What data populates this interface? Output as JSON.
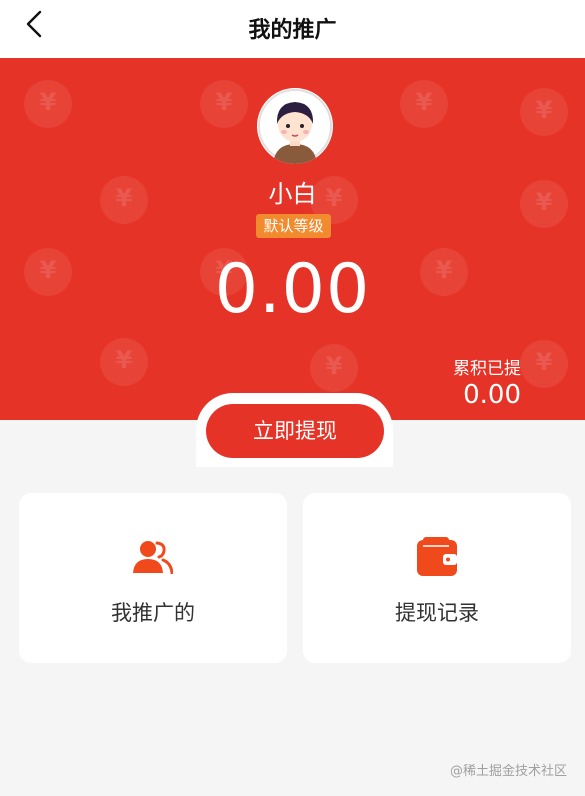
{
  "header": {
    "title": "我的推广"
  },
  "profile": {
    "name": "小白",
    "level": "默认等级"
  },
  "balance": {
    "amount": "0.00",
    "accumulated_label": "累积已提",
    "accumulated_value": "0.00"
  },
  "actions": {
    "withdraw_label": "立即提现"
  },
  "cards": [
    {
      "label": "我推广的",
      "icon": "users-icon"
    },
    {
      "label": "提现记录",
      "icon": "wallet-icon"
    }
  ],
  "colors": {
    "primary_red": "#e63327",
    "badge_orange": "#f28a2e",
    "icon_orange": "#f04a1c",
    "background": "#f5f5f5"
  },
  "watermark": "@稀土掘金技术社区"
}
